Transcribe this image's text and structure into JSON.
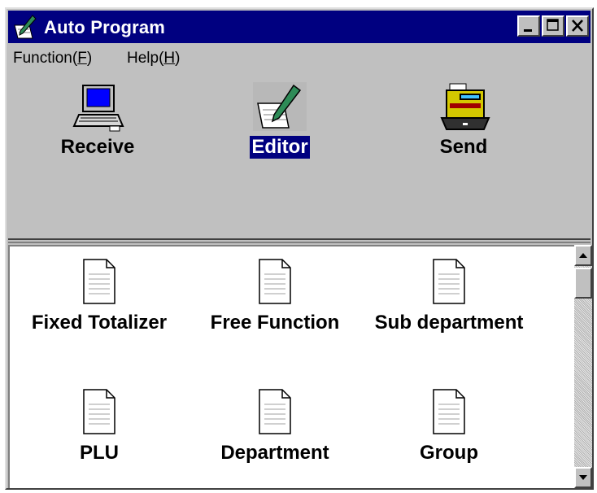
{
  "window": {
    "title": "Auto Program"
  },
  "menu": [
    {
      "label": "Function(",
      "key": "F",
      "suffix": ")"
    },
    {
      "label": "Help(",
      "key": "H",
      "suffix": ")"
    }
  ],
  "tools": [
    {
      "label": "Receive",
      "icon": "computer-icon",
      "selected": false
    },
    {
      "label": "Editor",
      "icon": "pen-notepad-icon",
      "selected": true
    },
    {
      "label": "Send",
      "icon": "cash-register-icon",
      "selected": false
    }
  ],
  "files": [
    {
      "label": "Fixed Totalizer",
      "icon": "document-icon"
    },
    {
      "label": "Free Function",
      "icon": "document-icon"
    },
    {
      "label": "Sub department",
      "icon": "document-icon"
    },
    {
      "label": "PLU",
      "icon": "document-icon"
    },
    {
      "label": "Department",
      "icon": "document-icon"
    },
    {
      "label": "Group",
      "icon": "document-icon"
    }
  ],
  "colors": {
    "titlebar": "#000080",
    "face": "#c0c0c0",
    "selection": "#000080"
  }
}
